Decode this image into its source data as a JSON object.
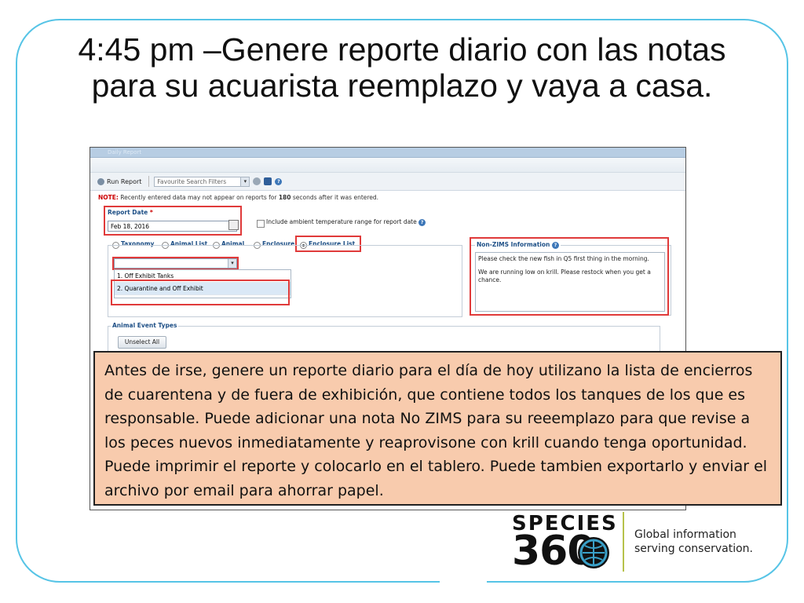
{
  "slide": {
    "title": "4:45 pm –Genere reporte diario con las notas para su acuarista reemplazo y vaya a casa."
  },
  "window": {
    "title": "Daily Report"
  },
  "toolbar": {
    "run_report_label": "Run Report",
    "favourite_placeholder": "Favourite Search Filters"
  },
  "note": {
    "label": "NOTE:",
    "text_before": " Recently entered data may not appear on reports for ",
    "seconds": "180",
    "text_after": " seconds after it was entered."
  },
  "report_date": {
    "label": "Report Date",
    "required_mark": "*",
    "value": "Feb 18, 2016"
  },
  "ambient_checkbox": {
    "label": "Include ambient temperature range for report date",
    "checked": false
  },
  "filter_type": {
    "options": [
      "Taxonomy",
      "Animal List",
      "Animal",
      "Enclosure",
      "Enclosure List"
    ],
    "selected": "Enclosure List"
  },
  "enclosure_list": {
    "items": [
      "1. Off Exhibit Tanks",
      "2. Quarantine and Off Exhibit"
    ],
    "selected_index": 1
  },
  "non_zims": {
    "label": "Non-ZIMS Information",
    "paragraph1": "Please check the new fish in Q5 first thing in the morning.",
    "paragraph2": "We are running low on krill. Please restock when you get a chance."
  },
  "animal_event_types": {
    "label": "Animal Event Types",
    "unselect_all_label": "Unselect All"
  },
  "callout": {
    "text": "Antes de irse, genere un reporte diario para el día de hoy utilizano la lista de encierros de cuarentena y de fuera de exhibición, que contiene todos los tanques de los que es responsable. Puede adicionar una nota No ZIMS para su reeemplazo para que revise a los peces nuevos inmediatamente y reaprovisone con krill cuando tenga oportunidad. Puede imprimir el reporte y colocarlo en el tablero. Puede tambien exportarlo y enviar el archivo por email para ahorrar papel."
  },
  "logo": {
    "word1": "SPECIES",
    "word2": "360",
    "tagline_line1": "Global information",
    "tagline_line2": "serving conservation."
  },
  "colors": {
    "frame": "#56c4e6",
    "highlight_box": "#e03a3a",
    "callout_bg": "#f8cbad",
    "logo_accent": "#b7c24a"
  }
}
